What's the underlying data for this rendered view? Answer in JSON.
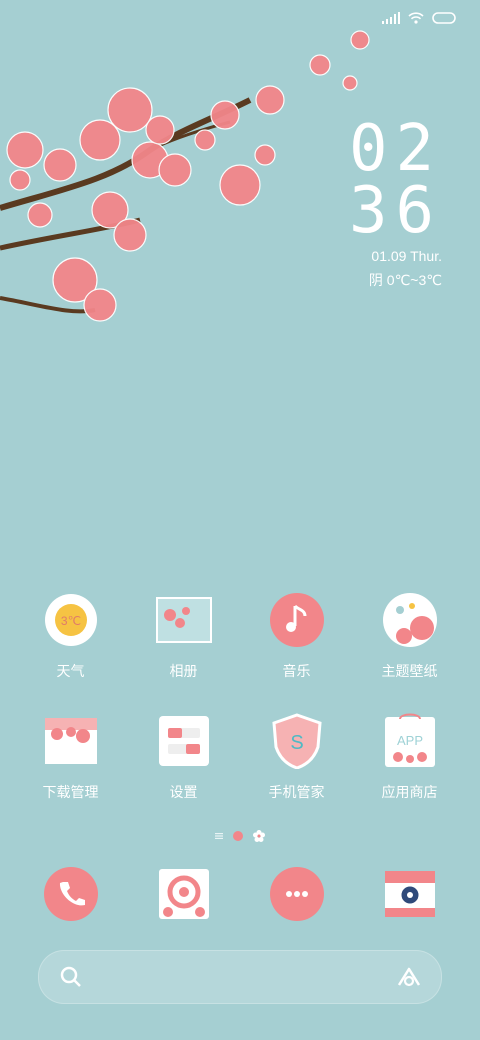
{
  "status_bar": {
    "icons": [
      "signal-icon",
      "wifi-icon",
      "battery-icon"
    ]
  },
  "clock": {
    "hour": "02",
    "minute": "36",
    "date": "01.09 Thur.",
    "weather": "阴 0℃~3℃"
  },
  "apps": [
    {
      "label": "天气",
      "icon": "weather-icon",
      "badge": "3℃"
    },
    {
      "label": "相册",
      "icon": "gallery-icon"
    },
    {
      "label": "音乐",
      "icon": "music-icon"
    },
    {
      "label": "主题壁纸",
      "icon": "themes-icon"
    },
    {
      "label": "下载管理",
      "icon": "downloads-icon"
    },
    {
      "label": "设置",
      "icon": "settings-icon"
    },
    {
      "label": "手机管家",
      "icon": "security-icon",
      "glyph": "S"
    },
    {
      "label": "应用商店",
      "icon": "app-store-icon",
      "glyph": "APP"
    }
  ],
  "dock": [
    {
      "icon": "phone-icon"
    },
    {
      "icon": "browser-icon"
    },
    {
      "icon": "messages-icon"
    },
    {
      "icon": "camera-icon"
    }
  ],
  "search": {
    "left_icon": "search-icon",
    "right_icon": "assistant-icon"
  },
  "colors": {
    "background": "#a5cfd2",
    "petal": "#f2868a",
    "branch": "#5a3a20"
  }
}
